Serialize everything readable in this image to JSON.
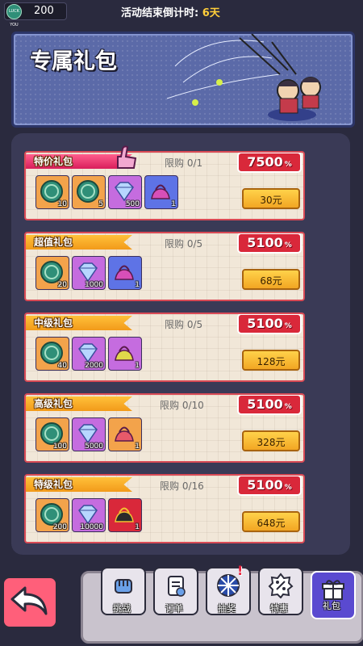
{
  "topbar": {
    "coin_icon_text": "LUCK YOU",
    "coins": "200",
    "timer_label": "活动结束倒计时:",
    "timer_value": "6天"
  },
  "banner": {
    "title": "专属礼包"
  },
  "packs": [
    {
      "name": "特价礼包",
      "limit": "限购 0/1",
      "discount": "7500",
      "price": "30元",
      "items": [
        {
          "icon": "luck-coin-icon",
          "qty": "10"
        },
        {
          "icon": "luck-coin-icon",
          "qty": "5"
        },
        {
          "icon": "gem-icon",
          "qty": "500"
        },
        {
          "icon": "bag-icon",
          "qty": "1"
        }
      ]
    },
    {
      "name": "超值礼包",
      "limit": "限购 0/5",
      "discount": "5100",
      "price": "68元",
      "items": [
        {
          "icon": "luck-coin-icon",
          "qty": "20"
        },
        {
          "icon": "gem-icon",
          "qty": "1000"
        },
        {
          "icon": "bag-icon",
          "qty": "1"
        }
      ]
    },
    {
      "name": "中级礼包",
      "limit": "限购 0/5",
      "discount": "5100",
      "price": "128元",
      "items": [
        {
          "icon": "luck-coin-icon",
          "qty": "40"
        },
        {
          "icon": "gem-icon",
          "qty": "2000"
        },
        {
          "icon": "bag-icon",
          "qty": "1"
        }
      ]
    },
    {
      "name": "高级礼包",
      "limit": "限购 0/10",
      "discount": "5100",
      "price": "328元",
      "items": [
        {
          "icon": "luck-coin-icon",
          "qty": "100"
        },
        {
          "icon": "gem-icon",
          "qty": "5000"
        },
        {
          "icon": "bag-icon",
          "qty": "1"
        }
      ]
    },
    {
      "name": "特级礼包",
      "limit": "限购 0/16",
      "discount": "5100",
      "price": "648元",
      "items": [
        {
          "icon": "luck-coin-icon",
          "qty": "200"
        },
        {
          "icon": "gem-icon",
          "qty": "10000"
        },
        {
          "icon": "bag-icon",
          "qty": "1"
        }
      ]
    }
  ],
  "nav": {
    "tabs": [
      {
        "label": "挑战"
      },
      {
        "label": "订单"
      },
      {
        "label": "抽奖"
      },
      {
        "label": "特惠"
      },
      {
        "label": "礼包"
      }
    ],
    "alert": "!"
  },
  "colors": {
    "accent_red": "#d9283a",
    "price_gold": "#f2a623",
    "active_tab": "#5a4ad0"
  }
}
